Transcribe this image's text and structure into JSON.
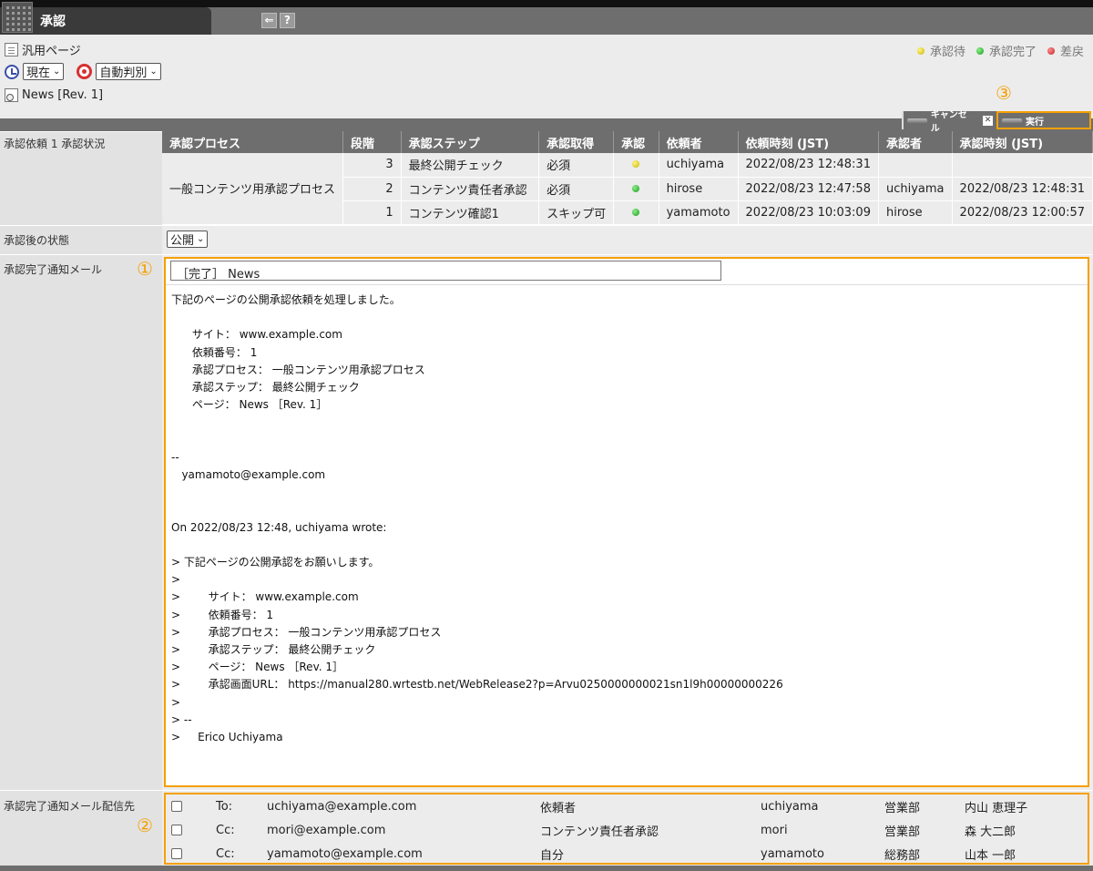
{
  "app": {
    "title": "承認",
    "btn_back": "⇐",
    "btn_help": "?"
  },
  "header": {
    "page_type": "汎用ページ",
    "time_select": "現在",
    "judge_select": "自動判別",
    "page_name": "News [Rev. 1]"
  },
  "legend": {
    "pending": "承認待",
    "done": "承認完了",
    "returned": "差戻"
  },
  "actions": {
    "cancel": "キャンセル",
    "execute": "実行"
  },
  "markers": {
    "one": "①",
    "two": "②",
    "three": "③"
  },
  "colors": {
    "accent": "#f5a000",
    "pending": "#c8b400",
    "done": "#1a9a1a",
    "returned": "#c02020"
  },
  "status": {
    "label": "承認依頼 1 承認状況",
    "headers": [
      "承認プロセス",
      "段階",
      "承認ステップ",
      "承認取得",
      "承認",
      "依頼者",
      "依頼時刻 (JST)",
      "承認者",
      "承認時刻 (JST)"
    ],
    "process_name": "一般コンテンツ用承認プロセス",
    "rows": [
      {
        "stage": "3",
        "step": "最終公開チェック",
        "required": "必須",
        "state": "pending",
        "requester": "uchiyama",
        "requested_at": "2022/08/23 12:48:31",
        "approver": "",
        "approved_at": ""
      },
      {
        "stage": "2",
        "step": "コンテンツ責任者承認",
        "required": "必須",
        "state": "done",
        "requester": "hirose",
        "requested_at": "2022/08/23 12:47:58",
        "approver": "uchiyama",
        "approved_at": "2022/08/23 12:48:31"
      },
      {
        "stage": "1",
        "step": "コンテンツ確認1",
        "required": "スキップ可",
        "state": "done",
        "requester": "yamamoto",
        "requested_at": "2022/08/23 10:03:09",
        "approver": "hirose",
        "approved_at": "2022/08/23 12:00:57"
      }
    ]
  },
  "after_state": {
    "label": "承認後の状態",
    "value": "公開"
  },
  "mail": {
    "label": "承認完了通知メール",
    "subject": "［完了］ News",
    "body": "下記のページの公開承認依頼を処理しました。\n\n      サイト： www.example.com\n      依頼番号： 1\n      承認プロセス： 一般コンテンツ用承認プロセス\n      承認ステップ： 最終公開チェック\n      ページ： News ［Rev. 1］\n\n\n--\n   yamamoto@example.com\n\n\nOn 2022/08/23 12:48, uchiyama wrote:\n\n> 下記ページの公開承認をお願いします。\n>\n>        サイト： www.example.com\n>        依頼番号： 1\n>        承認プロセス： 一般コンテンツ用承認プロセス\n>        承認ステップ： 最終公開チェック\n>        ページ： News ［Rev. 1］\n>        承認画面URL： https://manual280.wrtestb.net/WebRelease2?p=Arvu0250000000021sn1l9h00000000226\n>\n> --\n>     Erico Uchiyama"
  },
  "recipients": {
    "label": "承認完了通知メール配信先",
    "rows": [
      {
        "type": "To:",
        "email": "uchiyama@example.com",
        "role": "依頼者",
        "user": "uchiyama",
        "dept": "営業部",
        "name": "内山 恵理子"
      },
      {
        "type": "Cc:",
        "email": "mori@example.com",
        "role": "コンテンツ責任者承認",
        "user": "mori",
        "dept": "営業部",
        "name": "森 大二郎"
      },
      {
        "type": "Cc:",
        "email": "yamamoto@example.com",
        "role": "自分",
        "user": "yamamoto",
        "dept": "総務部",
        "name": "山本 一郎"
      }
    ]
  }
}
